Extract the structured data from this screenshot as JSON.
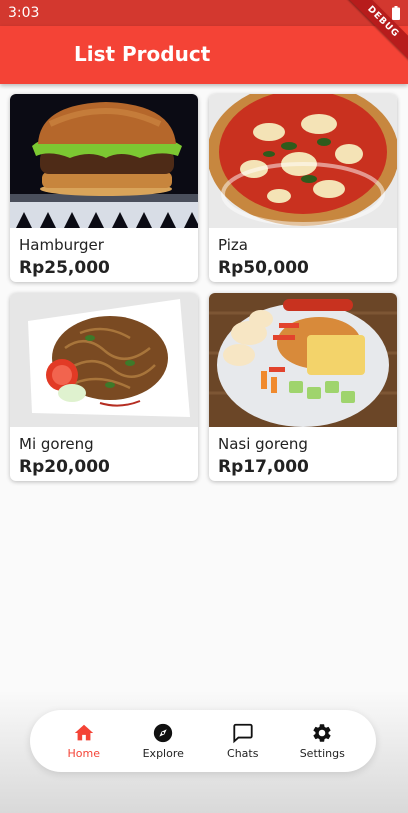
{
  "status_bar": {
    "time": "3:03"
  },
  "app_bar": {
    "title": "List Product",
    "debug_label": "DEBUG",
    "color": "#f44336"
  },
  "products": [
    {
      "name": "Hamburger",
      "price": "Rp25,000",
      "image": "hamburger"
    },
    {
      "name": "Piza",
      "price": "Rp50,000",
      "image": "pizza"
    },
    {
      "name": "Mi goreng",
      "price": "Rp20,000",
      "image": "fried-noodles"
    },
    {
      "name": "Nasi goreng",
      "price": "Rp17,000",
      "image": "fried-rice-plate"
    }
  ],
  "bottom_nav": {
    "active_color": "#f44336",
    "items": [
      {
        "label": "Home",
        "icon": "home-icon",
        "active": true
      },
      {
        "label": "Explore",
        "icon": "compass-icon",
        "active": false
      },
      {
        "label": "Chats",
        "icon": "chat-bubble-icon",
        "active": false
      },
      {
        "label": "Settings",
        "icon": "gear-icon",
        "active": false
      }
    ]
  }
}
